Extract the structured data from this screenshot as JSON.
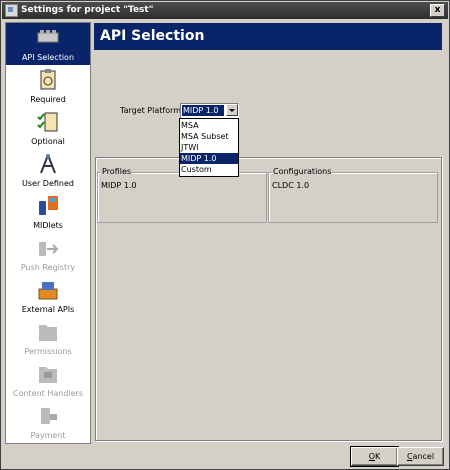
{
  "window": {
    "title": "Settings for project \"Test\"",
    "close_label": "x"
  },
  "sidebar": {
    "items": [
      {
        "label": "API Selection",
        "icon": "api-selection-icon",
        "selected": true,
        "enabled": true
      },
      {
        "label": "Required",
        "icon": "required-icon",
        "selected": false,
        "enabled": true
      },
      {
        "label": "Optional",
        "icon": "optional-icon",
        "selected": false,
        "enabled": true
      },
      {
        "label": "User Defined",
        "icon": "user-defined-icon",
        "selected": false,
        "enabled": true
      },
      {
        "label": "MIDlets",
        "icon": "midlets-icon",
        "selected": false,
        "enabled": true
      },
      {
        "label": "Push Registry",
        "icon": "push-registry-icon",
        "selected": false,
        "enabled": false
      },
      {
        "label": "External APIs",
        "icon": "external-apis-icon",
        "selected": false,
        "enabled": true
      },
      {
        "label": "Permissions",
        "icon": "permissions-icon",
        "selected": false,
        "enabled": false
      },
      {
        "label": "Content Handlers",
        "icon": "content-handlers-icon",
        "selected": false,
        "enabled": false
      },
      {
        "label": "Payment",
        "icon": "payment-icon",
        "selected": false,
        "enabled": false
      }
    ]
  },
  "main": {
    "header": "API Selection",
    "target_platform_label": "Target Platform",
    "target_platform_value": "MIDP 1.0",
    "dropdown_options": [
      "MSA",
      "MSA Subset",
      "JTWI",
      "MIDP 1.0",
      "Custom"
    ],
    "dropdown_selected": "MIDP 1.0",
    "profiles": {
      "title": "Profiles",
      "value": "MIDP 1.0"
    },
    "configurations": {
      "title": "Configurations",
      "value": "CLDC 1.0"
    }
  },
  "buttons": {
    "ok_mnemonic": "O",
    "ok_rest": "K",
    "cancel_mnemonic": "C",
    "cancel_rest": "ancel"
  },
  "colors": {
    "selection": "#0a246a",
    "dialog_bg": "#d4d0c8",
    "header_bg": "#0a246a"
  }
}
